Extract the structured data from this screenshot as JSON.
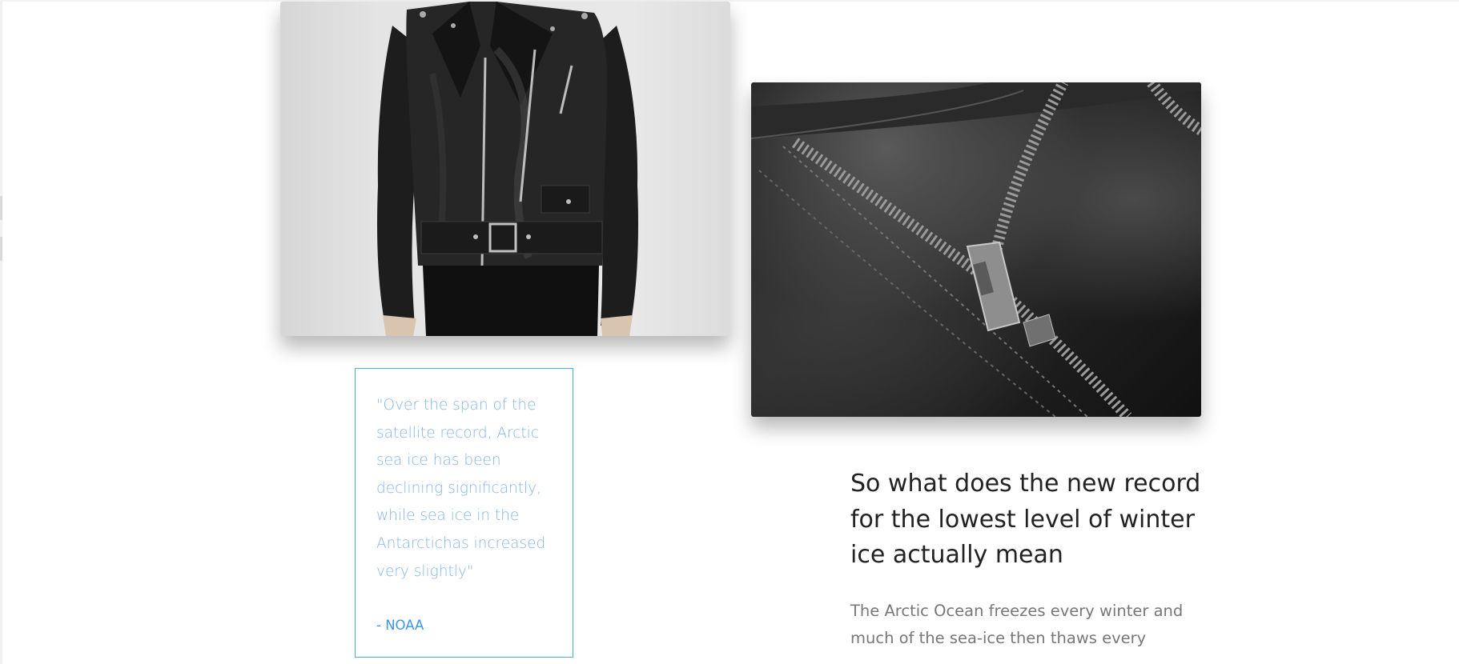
{
  "quote": {
    "text": "\"Over the span of the satellite record, Arctic sea ice has been declining significantly, while sea ice in the Antarctichas increased very slightly\"",
    "source": "- NOAA"
  },
  "article": {
    "title": "So what does the new record for the lowest level of winter ice actually mean",
    "body": "The Arctic Ocean freezes every winter and much of the sea-ice then thaws every"
  },
  "colors": {
    "quote_border": "#4aaee6",
    "quote_text": "#84b6ee",
    "quote_source": "#3d95e6",
    "title_text": "#222222",
    "body_text": "#777777"
  }
}
